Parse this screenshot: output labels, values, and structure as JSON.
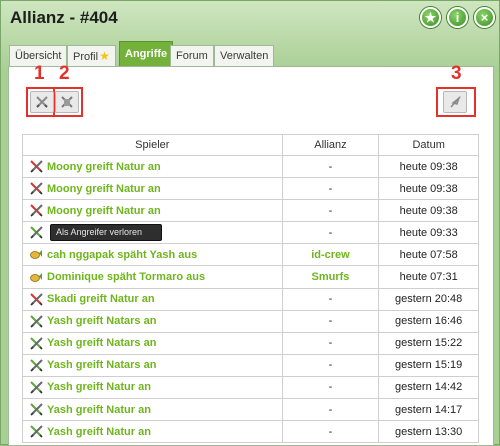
{
  "window": {
    "title": "Allianz - #404"
  },
  "tabs": [
    {
      "label": "Übersicht"
    },
    {
      "label": "Profil"
    },
    {
      "label": "Angriffe"
    },
    {
      "label": "Forum"
    },
    {
      "label": "Verwalten"
    }
  ],
  "markers": [
    "1",
    "2",
    "3"
  ],
  "table": {
    "headers": [
      "Spieler",
      "Allianz",
      "Datum"
    ],
    "rows": [
      {
        "icon": "attack-lost-icon",
        "text": "Moony greift Natur an",
        "allianz": "-",
        "datum": "heute 09:38"
      },
      {
        "icon": "attack-lost-icon",
        "text": "Moony greift Natur an",
        "allianz": "-",
        "datum": "heute 09:38"
      },
      {
        "icon": "attack-lost-icon",
        "text": "Moony greift Natur an",
        "allianz": "-",
        "datum": "heute 09:38"
      },
      {
        "icon": "attack-won-icon",
        "text": "",
        "allianz": "-",
        "datum": "heute 09:33"
      },
      {
        "icon": "spy-icon",
        "text": "cah nggapak späht Yash aus",
        "allianz": "id-crew",
        "datum": "heute 07:58"
      },
      {
        "icon": "spy-icon",
        "text": "Dominique späht Tormaro aus",
        "allianz": "Smurfs",
        "datum": "heute 07:31"
      },
      {
        "icon": "attack-lost-icon",
        "text": "Skadi greift Natur an",
        "allianz": "-",
        "datum": "gestern 20:48"
      },
      {
        "icon": "attack-won-icon",
        "text": "Yash greift Natars an",
        "allianz": "-",
        "datum": "gestern 16:46"
      },
      {
        "icon": "attack-won-icon",
        "text": "Yash greift Natars an",
        "allianz": "-",
        "datum": "gestern 15:22"
      },
      {
        "icon": "attack-won-icon",
        "text": "Yash greift Natars an",
        "allianz": "-",
        "datum": "gestern 15:19"
      },
      {
        "icon": "attack-won-icon",
        "text": "Yash greift Natur an",
        "allianz": "-",
        "datum": "gestern 14:42"
      },
      {
        "icon": "attack-won-icon",
        "text": "Yash greift Natur an",
        "allianz": "-",
        "datum": "gestern 14:17"
      },
      {
        "icon": "attack-won-icon",
        "text": "Yash greift Natur an",
        "allianz": "-",
        "datum": "gestern 13:30"
      }
    ]
  },
  "tooltip": "Als Angreifer verloren",
  "colors": {
    "accent": "#73b13a",
    "link": "#6fb51e",
    "highlight": "#e4312b"
  }
}
